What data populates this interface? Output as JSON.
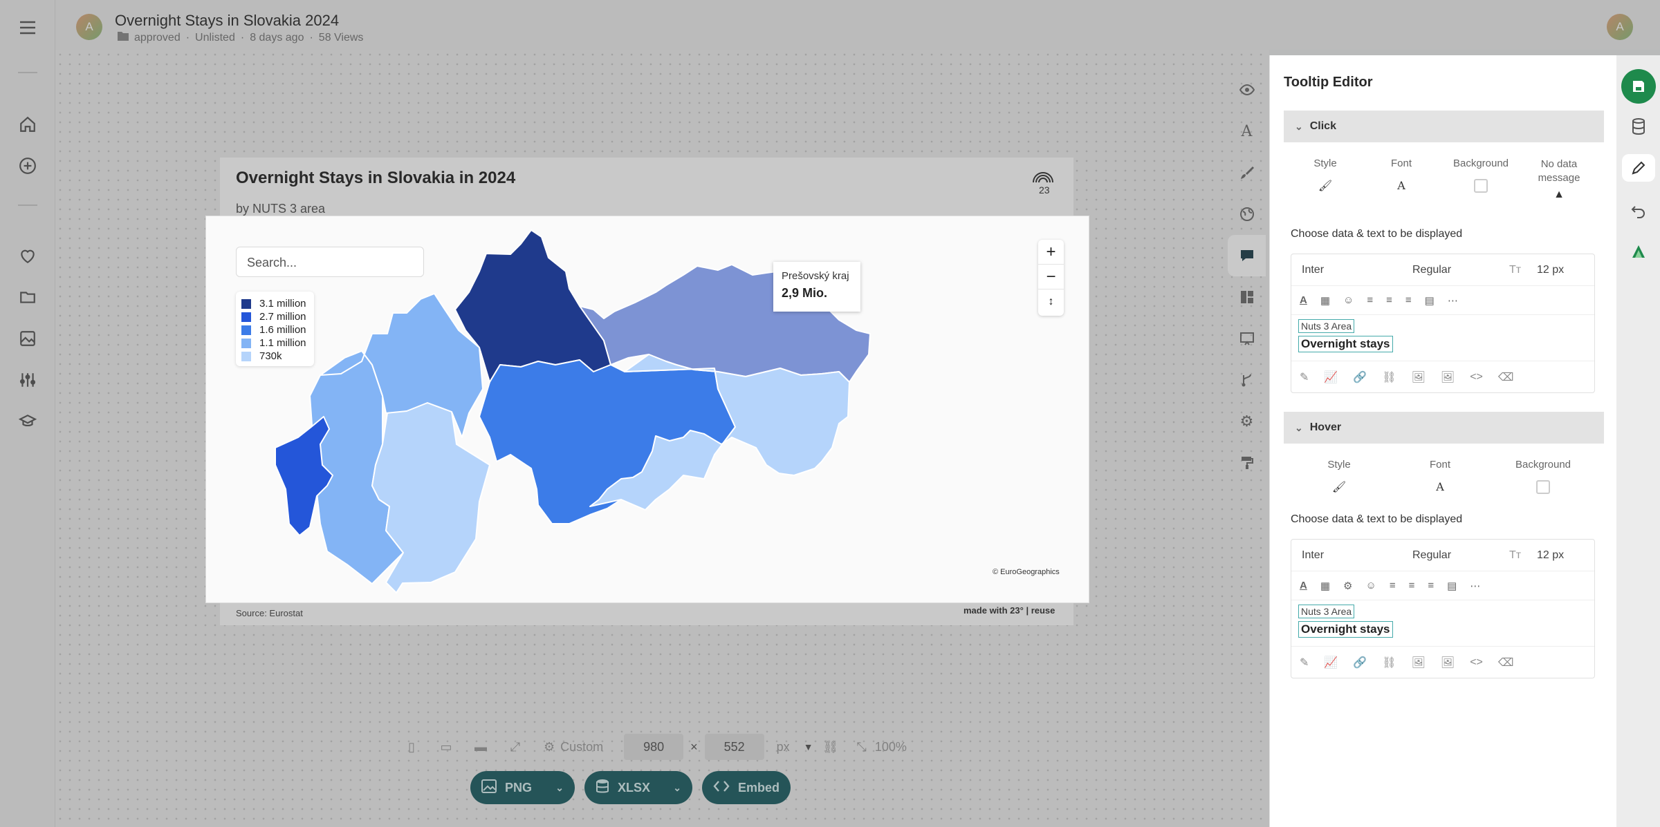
{
  "header": {
    "title": "Overnight Stays in Slovakia 2024",
    "avatar_initial": "A",
    "folder": "approved",
    "visibility": "Unlisted",
    "updated": "8 days ago",
    "views": "58 Views"
  },
  "chart": {
    "title": "Overnight Stays in Slovakia in 2024",
    "subtitle": "by NUTS 3 area",
    "source": "Source: Eurostat",
    "made_with": "made with 23° | reuse",
    "credits": "© EuroGeographics",
    "search_placeholder": "Search...",
    "legend": [
      {
        "label": "3.1 million",
        "color": "#1f3a8c"
      },
      {
        "label": "2.7 million",
        "color": "#2456d9"
      },
      {
        "label": "1.6 million",
        "color": "#3c7ce8"
      },
      {
        "label": "1.1 million",
        "color": "#83b4f5"
      },
      {
        "label": "730k",
        "color": "#b5d4fb"
      }
    ],
    "tooltip": {
      "region": "Prešovský kraj",
      "value": "2,9 Mio."
    },
    "zoom": {
      "in": "+",
      "out": "−",
      "reset": "↕"
    }
  },
  "chart_data": {
    "type": "choropleth",
    "title": "Overnight Stays in Slovakia in 2024",
    "subtitle": "by NUTS 3 area",
    "regions": [
      {
        "name": "Prešovský kraj",
        "value": "2,9 Mio."
      }
    ],
    "legend_bins": [
      "3.1 million",
      "2.7 million",
      "1.6 million",
      "1.1 million",
      "730k"
    ]
  },
  "devbar": {
    "preset": "Custom",
    "width": "980",
    "times": "×",
    "height": "552",
    "unit": "px",
    "zoom": "100%"
  },
  "export": {
    "png": "PNG",
    "xlsx": "XLSX",
    "embed": "Embed"
  },
  "panel": {
    "title": "Tooltip Editor",
    "click": {
      "section": "Click",
      "opts": [
        "Style",
        "Font",
        "Background",
        "No data message"
      ],
      "choose": "Choose data & text to be displayed",
      "font": "Inter",
      "weight": "Regular",
      "size": "12 px",
      "chip1": "Nuts 3 Area",
      "chip2": "Overnight stays"
    },
    "hover": {
      "section": "Hover",
      "opts": [
        "Style",
        "Font",
        "Background"
      ],
      "choose": "Choose data & text to be displayed",
      "font": "Inter",
      "weight": "Regular",
      "size": "12 px",
      "chip1": "Nuts 3 Area",
      "chip2": "Overnight stays"
    }
  },
  "colors": {
    "accent": "#1c5d63",
    "save": "#1e8a4c"
  }
}
